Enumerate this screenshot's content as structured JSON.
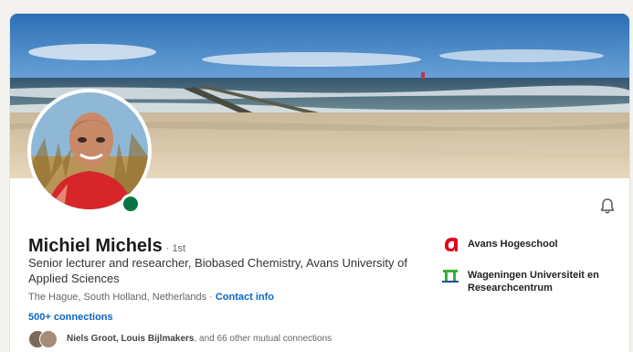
{
  "profile": {
    "name": "Michiel Michels",
    "degree": "· 1st",
    "headline": "Senior lecturer and researcher, Biobased Chemistry, Avans University of Applied Sciences",
    "location": "The Hague, South Holland, Netherlands",
    "location_sep": " · ",
    "contact_link": "Contact info",
    "connections": "500+ connections",
    "mutual_names": "Niels Groot, Louis Bijlmakers",
    "mutual_rest": ", and 66 other mutual connections"
  },
  "experience": [
    {
      "name": "Avans Hogeschool",
      "logo": "avans-logo"
    },
    {
      "name": "Wageningen Universiteit en Researchcentrum",
      "logo": "wur-logo"
    }
  ],
  "icons": {
    "notify": "bell-icon",
    "presence": "online-status"
  },
  "colors": {
    "link": "#0a66c2",
    "presence": "#057642",
    "avans_red": "#e3001b",
    "wur_green": "#34b233",
    "page_bg": "#f3f2ef"
  }
}
